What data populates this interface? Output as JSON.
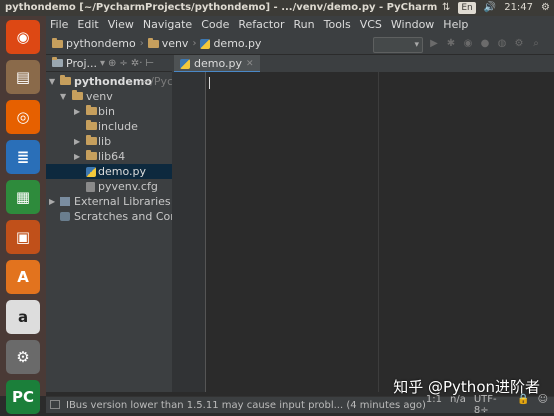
{
  "window": {
    "title": "pythondemo [~/PycharmProjects/pythondemo] - .../venv/demo.py - PyCharm",
    "tray": {
      "arrows": "⇅",
      "keyboard": "En",
      "volume": "🔊",
      "time": "21:47",
      "gear": "⚙"
    }
  },
  "menu": [
    "File",
    "Edit",
    "View",
    "Navigate",
    "Code",
    "Refactor",
    "Run",
    "Tools",
    "VCS",
    "Window",
    "Help"
  ],
  "breadcrumb": [
    {
      "label": "pythondemo",
      "icon": "folder-icon"
    },
    {
      "label": "venv",
      "icon": "folder-icon"
    },
    {
      "label": "demo.py",
      "icon": "python-file-icon"
    }
  ],
  "project_panel": {
    "title": "Proj...",
    "tree": [
      {
        "label": "pythondemo",
        "suffix": "~/Pych",
        "icon": "folder-icon",
        "expanded": true
      },
      {
        "label": "venv",
        "icon": "folder-icon",
        "expanded": true
      },
      {
        "label": "bin",
        "icon": "folder-icon",
        "expanded": false
      },
      {
        "label": "include",
        "icon": "folder-icon"
      },
      {
        "label": "lib",
        "icon": "folder-icon",
        "expanded": false
      },
      {
        "label": "lib64",
        "icon": "folder-icon",
        "expanded": false
      },
      {
        "label": "demo.py",
        "icon": "python-file-icon",
        "selected": true
      },
      {
        "label": "pyvenv.cfg",
        "icon": "config-file-icon"
      },
      {
        "label": "External Libraries",
        "icon": "library-icon",
        "expanded": false
      },
      {
        "label": "Scratches and Consol",
        "icon": "scratch-icon"
      }
    ]
  },
  "editor": {
    "tab_label": "demo.py"
  },
  "status": {
    "message": "IBus version lower than 1.5.11 may cause input probl... (4 minutes ago)",
    "position": "1:1",
    "line_sep": "n/a",
    "encoding": "UTF-8÷"
  },
  "watermark": "知乎 @Python进阶者",
  "launcher": [
    {
      "name": "ubuntu-dash-icon",
      "glyph": "◉",
      "color": "#dd4814"
    },
    {
      "name": "files-icon",
      "glyph": "▤",
      "color": "#8a6a4a"
    },
    {
      "name": "firefox-icon",
      "glyph": "◎",
      "color": "#e66000"
    },
    {
      "name": "writer-icon",
      "glyph": "≣",
      "color": "#2a6fb8"
    },
    {
      "name": "calc-icon",
      "glyph": "▦",
      "color": "#2e8b3c"
    },
    {
      "name": "impress-icon",
      "glyph": "▣",
      "color": "#c0501a"
    },
    {
      "name": "software-center-icon",
      "glyph": "A",
      "color": "#e2731e"
    },
    {
      "name": "amazon-icon",
      "glyph": "a",
      "color": "#ddd"
    },
    {
      "name": "system-settings-icon",
      "glyph": "⚙",
      "color": "#6a6a6a"
    },
    {
      "name": "pycharm-icon",
      "glyph": "PC",
      "color": "#1b7f3a"
    }
  ]
}
